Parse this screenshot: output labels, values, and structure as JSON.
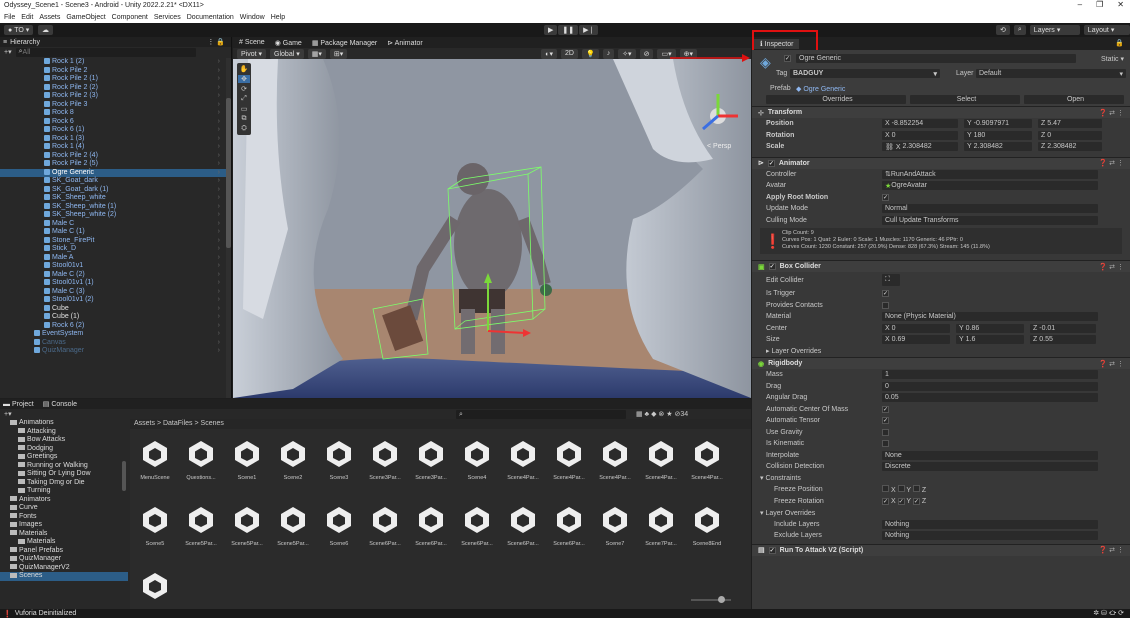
{
  "window": {
    "title": "Odyssey_Scene1 - Scene3 - Android - Unity 2022.2.21* <DX11>",
    "min": "–",
    "max": "❐",
    "close": "✕"
  },
  "menu": [
    "File",
    "Edit",
    "Assets",
    "GameObject",
    "Component",
    "Services",
    "Documentation",
    "Window",
    "Help"
  ],
  "toolbar": {
    "account": "TO ▾",
    "layers": "Layers",
    "layout": "Layout"
  },
  "hierarchy": {
    "tab": "Hierarchy",
    "search_placeholder": "All",
    "items": [
      {
        "label": "Rock 1 (2)",
        "indent": 1,
        "style": "normal"
      },
      {
        "label": "Rock Pile 2",
        "indent": 1,
        "style": "normal"
      },
      {
        "label": "Rock Pile 2 (1)",
        "indent": 1,
        "style": "normal"
      },
      {
        "label": "Rock Pile 2 (2)",
        "indent": 1,
        "style": "normal"
      },
      {
        "label": "Rock Pile 2 (3)",
        "indent": 1,
        "style": "normal"
      },
      {
        "label": "Rock Pile 3",
        "indent": 1,
        "style": "normal"
      },
      {
        "label": "Rock 8",
        "indent": 1,
        "style": "normal"
      },
      {
        "label": "Rock 6",
        "indent": 1,
        "style": "normal"
      },
      {
        "label": "Rock 6 (1)",
        "indent": 1,
        "style": "normal"
      },
      {
        "label": "Rock 1 (3)",
        "indent": 1,
        "style": "normal"
      },
      {
        "label": "Rock 1 (4)",
        "indent": 1,
        "style": "normal"
      },
      {
        "label": "Rock Pile 2 (4)",
        "indent": 1,
        "style": "normal"
      },
      {
        "label": "Rock Pile 2 (5)",
        "indent": 1,
        "style": "normal"
      },
      {
        "label": "Ogre Generic",
        "indent": 1,
        "style": "sel"
      },
      {
        "label": "SK_Goat_dark",
        "indent": 1,
        "style": "normal"
      },
      {
        "label": "SK_Goat_dark (1)",
        "indent": 1,
        "style": "normal"
      },
      {
        "label": "SK_Sheep_white",
        "indent": 1,
        "style": "normal"
      },
      {
        "label": "SK_Sheep_white (1)",
        "indent": 1,
        "style": "normal"
      },
      {
        "label": "SK_Sheep_white (2)",
        "indent": 1,
        "style": "normal"
      },
      {
        "label": "Male C",
        "indent": 1,
        "style": "normal"
      },
      {
        "label": "Male C (1)",
        "indent": 1,
        "style": "normal"
      },
      {
        "label": "Stone_FirePit",
        "indent": 1,
        "style": "normal"
      },
      {
        "label": "Stick_D",
        "indent": 1,
        "style": "normal"
      },
      {
        "label": "Male A",
        "indent": 1,
        "style": "normal"
      },
      {
        "label": "Stool01v1",
        "indent": 1,
        "style": "normal"
      },
      {
        "label": "Male C (2)",
        "indent": 1,
        "style": "normal"
      },
      {
        "label": "Stool01v1 (1)",
        "indent": 1,
        "style": "normal"
      },
      {
        "label": "Male C (3)",
        "indent": 1,
        "style": "normal"
      },
      {
        "label": "Stool01v1 (2)",
        "indent": 1,
        "style": "normal"
      },
      {
        "label": "Cube",
        "indent": 1,
        "style": "white"
      },
      {
        "label": "Cube (1)",
        "indent": 1,
        "style": "white"
      },
      {
        "label": "Rock 6 (2)",
        "indent": 1,
        "style": "normal"
      },
      {
        "label": "EventSystem",
        "indent": 0,
        "style": "normal"
      },
      {
        "label": "Canvas",
        "indent": 0,
        "style": "dim"
      },
      {
        "label": "QuizManager",
        "indent": 0,
        "style": "dim"
      }
    ]
  },
  "scene": {
    "tabs": [
      "Scene",
      "Game",
      "Package Manager",
      "Animator"
    ],
    "pivot": "Pivot ▾",
    "global": "Global ▾",
    "mode2d": "2D",
    "persp": "< Persp"
  },
  "project": {
    "tabs": [
      "Project",
      "Console"
    ],
    "breadcrumb": "Assets > DataFiles > Scenes",
    "count": "34",
    "folders": [
      "Animations",
      "Attacking",
      "Bow Attacks",
      "Dodging",
      "Greetings",
      "Running or Walking",
      "Sitting Or Lying Dow",
      "Taking Dmg or Die",
      "Turning",
      "Animators",
      "Curve",
      "Fonts",
      "Images",
      "Materials",
      "Materials",
      "Panel Prefabs",
      "QuizManager",
      "QuizManagerV2",
      "Scenes"
    ],
    "row1": [
      "MenuScene",
      "Questions...",
      "Scene1",
      "Scene2",
      "Scene3",
      "Scene3Par...",
      "Scene3Par...",
      "Scene4",
      "Scene4Par...",
      "Scene4Par...",
      "Scene4Par...",
      "Scene4Par...",
      "Scene4Par..."
    ],
    "row2": [
      "Scene5",
      "Scene5Par...",
      "Scene5Par...",
      "Scene5Par...",
      "Scene6",
      "Scene6Par...",
      "Scene6Par...",
      "Scene6Par...",
      "Scene6Par...",
      "Scene6Par...",
      "Scene7",
      "Scene7Par...",
      "Scene8End"
    ]
  },
  "inspector": {
    "tab": "Inspector",
    "object_name": "Ogre Generic",
    "static": "Static ▾",
    "tag_label": "Tag",
    "tag": "BADGUY",
    "layer_label": "Layer",
    "layer": "Default",
    "prefab_label": "Prefab",
    "prefab": "Ogre Generic",
    "overrides": "Overrides",
    "select": "Select",
    "open": "Open",
    "transform": {
      "title": "Transform",
      "position": [
        "-8.852254",
        "-0.9097971",
        "5.47"
      ],
      "rotation": [
        "0",
        "180",
        "0"
      ],
      "scale": [
        "2.308482",
        "2.308482",
        "2.308482"
      ]
    },
    "animator": {
      "title": "Animator",
      "controller": "RunAndAttack",
      "avatar": "OgreAvatar",
      "apply_root": "✓",
      "update_mode": "Normal",
      "culling": "Cull Update Transforms",
      "info1": "Clip Count: 9",
      "info2": "Curves Pos: 1 Quat: 2 Euler: 0 Scale: 1 Muscles: 1170 Generic: 46 PPtr: 0",
      "info3": "Curves Count: 1230 Constant: 257 (20.9%) Dense: 828 (67.3%) Stream: 145 (11.8%)"
    },
    "box": {
      "title": "Box Collider",
      "is_trigger": "✓",
      "material": "None (Physic Material)",
      "center": [
        "0",
        "0.86",
        "-0.01"
      ],
      "size": [
        "0.69",
        "1.6",
        "0.55"
      ]
    },
    "rb": {
      "title": "Rigidbody",
      "mass": "1",
      "drag": "0",
      "angular": "0.05",
      "auto_com": "✓",
      "auto_tensor": "✓",
      "interpolate": "None",
      "collision": "Discrete",
      "include": "Nothing",
      "exclude": "Nothing"
    },
    "script": {
      "title": "Run To Attack V2 (Script)"
    }
  },
  "status": "Vuforia Deinitialized"
}
